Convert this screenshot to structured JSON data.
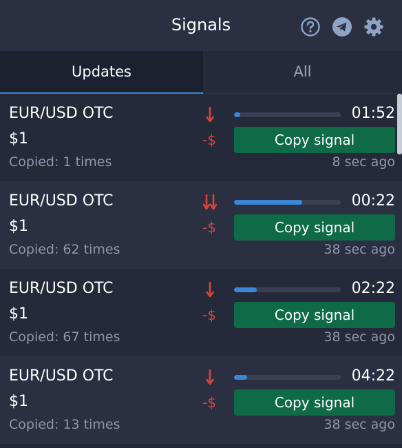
{
  "header": {
    "title": "Signals",
    "icons": [
      "help-icon",
      "telegram-icon",
      "gear-icon"
    ]
  },
  "tabs": [
    {
      "label": "Updates",
      "active": true
    },
    {
      "label": "All",
      "active": false
    }
  ],
  "colors": {
    "background": "#232838",
    "header": "#2a3042",
    "accent_tab": "#3e83d9",
    "copy_button": "#0e6a47",
    "down": "#d9433a",
    "progress": "#3a87d8",
    "muted_text": "#8d96ab"
  },
  "signals": [
    {
      "pair": "EUR/USD OTC",
      "amount": "$1",
      "copied": "Copied: 1 times",
      "direction": "down",
      "direction_strength": 1,
      "profit": "-$",
      "progress": 0.06,
      "timer": "01:52",
      "copy_label": "Copy signal",
      "ago": "8 sec ago"
    },
    {
      "pair": "EUR/USD OTC",
      "amount": "$1",
      "copied": "Copied: 62 times",
      "direction": "down",
      "direction_strength": 2,
      "profit": "-$",
      "progress": 0.64,
      "timer": "00:22",
      "copy_label": "Copy signal",
      "ago": "38 sec ago"
    },
    {
      "pair": "EUR/USD OTC",
      "amount": "$1",
      "copied": "Copied: 67 times",
      "direction": "down",
      "direction_strength": 1,
      "profit": "-$",
      "progress": 0.21,
      "timer": "02:22",
      "copy_label": "Copy signal",
      "ago": "38 sec ago"
    },
    {
      "pair": "EUR/USD OTC",
      "amount": "$1",
      "copied": "Copied: 13 times",
      "direction": "down",
      "direction_strength": 1,
      "profit": "-$",
      "progress": 0.12,
      "timer": "04:22",
      "copy_label": "Copy signal",
      "ago": "38 sec ago"
    }
  ]
}
